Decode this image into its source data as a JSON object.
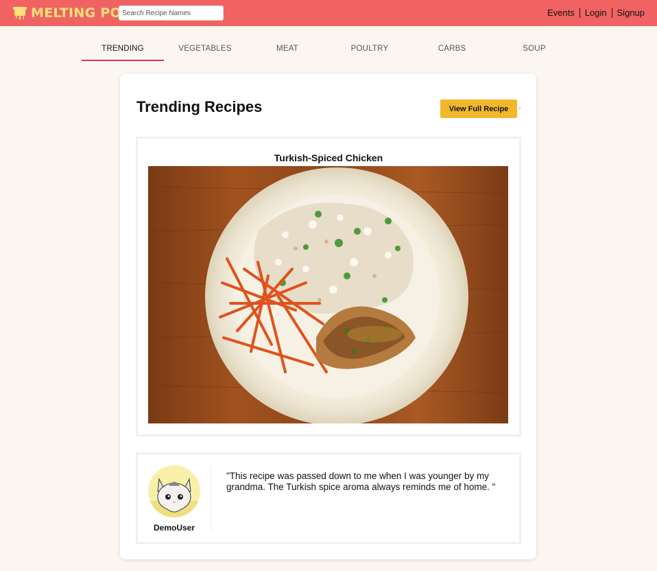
{
  "header": {
    "logo_text": "MELTING POT",
    "search_placeholder": "Search Recipe Names",
    "links": [
      "Events",
      "Login",
      "Signup"
    ],
    "colors": {
      "bar": "#f06362",
      "logo": "#fde27b"
    }
  },
  "tabs": [
    {
      "label": "TRENDING",
      "active": true
    },
    {
      "label": "VEGETABLES",
      "active": false
    },
    {
      "label": "MEAT",
      "active": false
    },
    {
      "label": "POULTRY",
      "active": false
    },
    {
      "label": "CARBS",
      "active": false
    },
    {
      "label": "SOUP",
      "active": false
    }
  ],
  "main": {
    "title": "Trending Recipes",
    "view_button": "View Full Recipe",
    "recipe_name": "Turkish-Spiced Chicken",
    "comment": {
      "user": "DemoUser",
      "text": "\"This recipe was passed down to me when I was younger by my grandma. The Turkish spice aroma always reminds me of home. \""
    }
  },
  "icons": {
    "logo": "melting-pot-icon",
    "avatar": "cat-avatar"
  },
  "accent": {
    "tab_underline": "#d6336c",
    "button": "#f2b82b"
  }
}
